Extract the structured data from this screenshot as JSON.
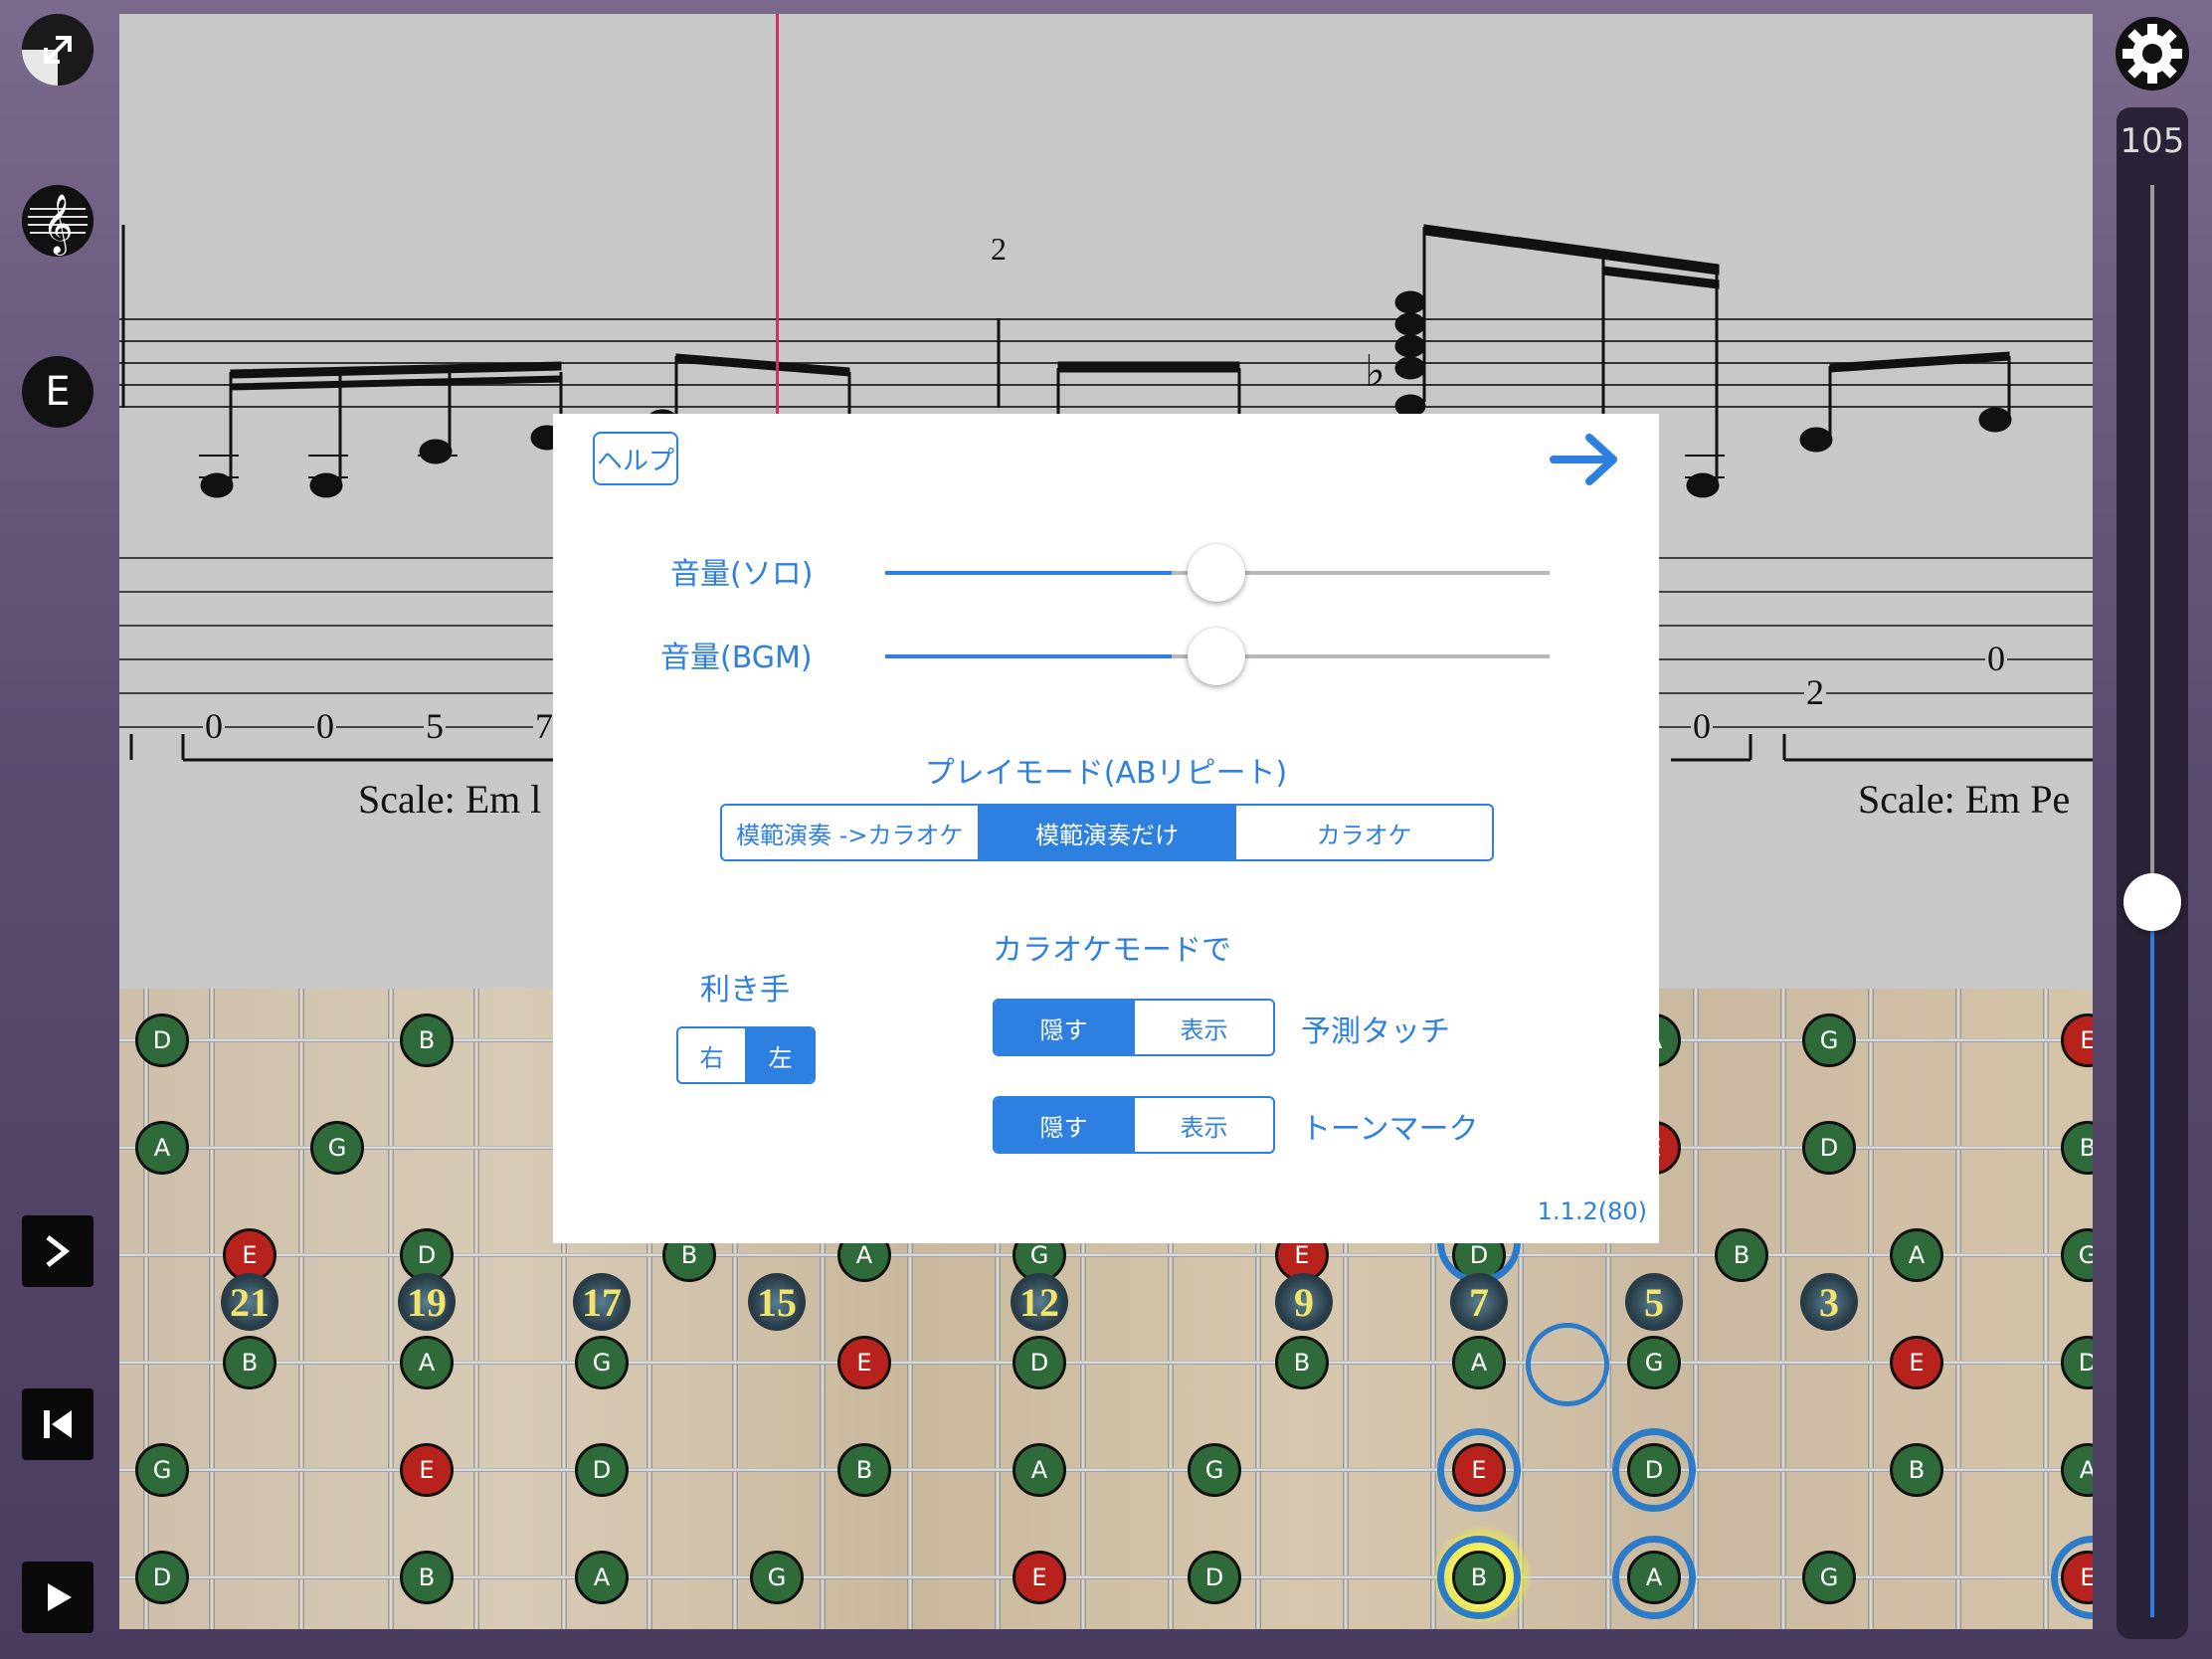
{
  "toolbar": {
    "left_icons": [
      "resize-icon",
      "treble-clef-icon"
    ],
    "key_label": "E",
    "next_icon": "chevron-right-icon",
    "rewind_icon": "skip-back-icon",
    "play_icon": "play-icon",
    "settings_icon": "gear-icon"
  },
  "tempo": {
    "value": "105",
    "level": 0.46
  },
  "score": {
    "measure_number": "2",
    "flat_symbol": "♭",
    "tab_numbers": [
      "0",
      "0",
      "5",
      "7",
      "0",
      "2",
      "0"
    ],
    "scale_text_left": "Scale: Em l",
    "scale_text_right": "Scale: Em Pe"
  },
  "fretboard": {
    "fret_markers": [
      "21",
      "19",
      "17",
      "15",
      "12",
      "9",
      "7",
      "5",
      "3"
    ]
  },
  "dialog": {
    "help_label": "ヘルプ",
    "forward_icon": "arrow-right-icon",
    "volume_solo_label": "音量(ソロ)",
    "volume_solo_value": 0.5,
    "volume_bgm_label": "音量(BGM)",
    "volume_bgm_value": 0.5,
    "play_mode_title": "プレイモード(ABリピート)",
    "play_mode_options": [
      "模範演奏 ->カラオケ",
      "模範演奏だけ",
      "カラオケ"
    ],
    "play_mode_selected": "模範演奏だけ",
    "handedness_title": "利き手",
    "handedness_options": [
      "右",
      "左"
    ],
    "handedness_selected": "左",
    "karaoke_title": "カラオケモードで",
    "hide_label": "隠す",
    "show_label": "表示",
    "prediction_label": "予測タッチ",
    "prediction_selected": "隠す",
    "tone_mark_label": "トーンマーク",
    "tone_mark_selected": "隠す",
    "version": "1.1.2(80)"
  },
  "colors": {
    "accent": "#2d7fe0",
    "note_green": "#2f6b3a",
    "note_red": "#b8221c",
    "playhead": "#d0306a",
    "highlight": "#e9e84a"
  }
}
